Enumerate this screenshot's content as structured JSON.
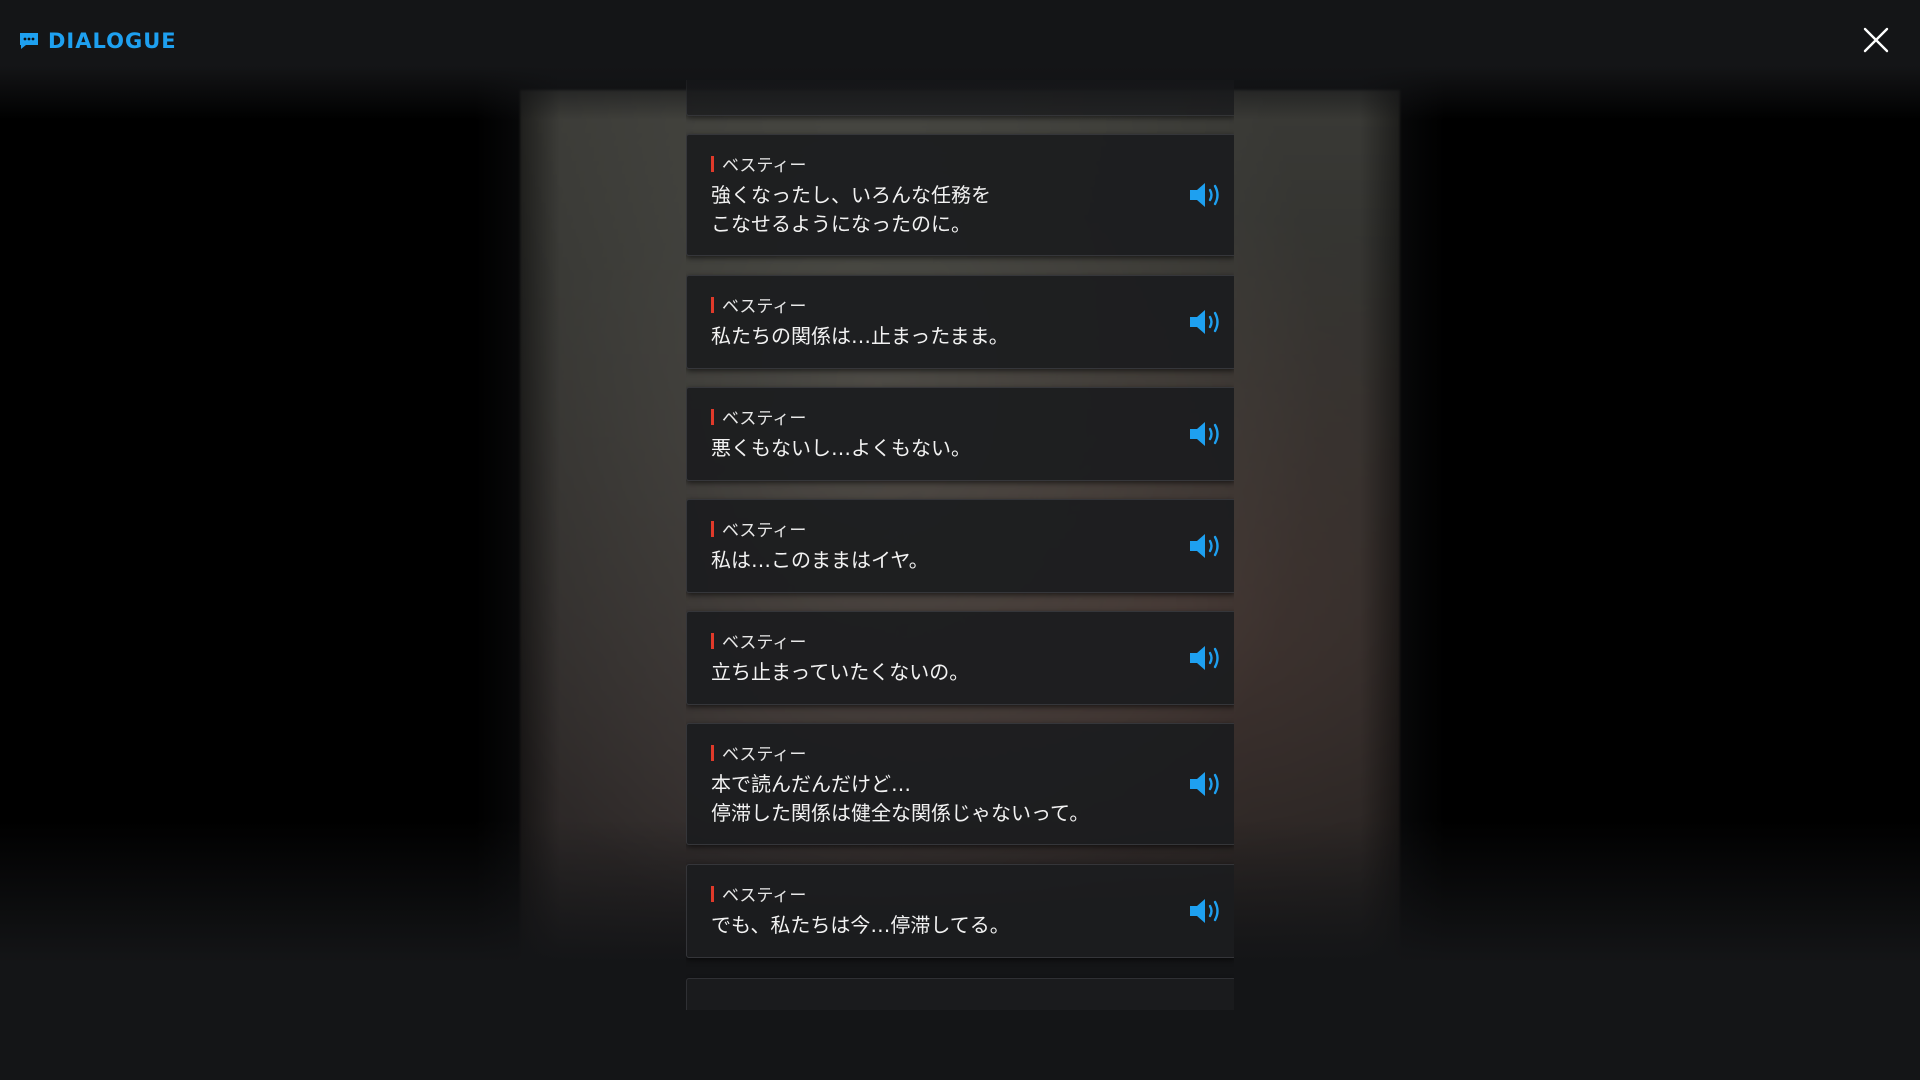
{
  "header": {
    "title": "DIALOGUE",
    "title_icon": "chat-icon",
    "close_icon": "close-icon",
    "accent_color": "#1ea0f0"
  },
  "dialogue": {
    "entries": [
      {
        "speaker": "ベスティー",
        "text": "強くなったし、いろんな任務を\nこなせるようになったのに。"
      },
      {
        "speaker": "ベスティー",
        "text": "私たちの関係は…止まったまま。"
      },
      {
        "speaker": "ベスティー",
        "text": "悪くもないし…よくもない。"
      },
      {
        "speaker": "ベスティー",
        "text": "私は…このままはイヤ。"
      },
      {
        "speaker": "ベスティー",
        "text": "立ち止まっていたくないの。"
      },
      {
        "speaker": "ベスティー",
        "text": "本で読んだんだけど…\n停滞した関係は健全な関係じゃないって。"
      },
      {
        "speaker": "ベスティー",
        "text": "でも、私たちは今…停滞してる。"
      }
    ],
    "voice_icon": "speaker-icon",
    "speaker_marker_color": "#e03a2a"
  }
}
